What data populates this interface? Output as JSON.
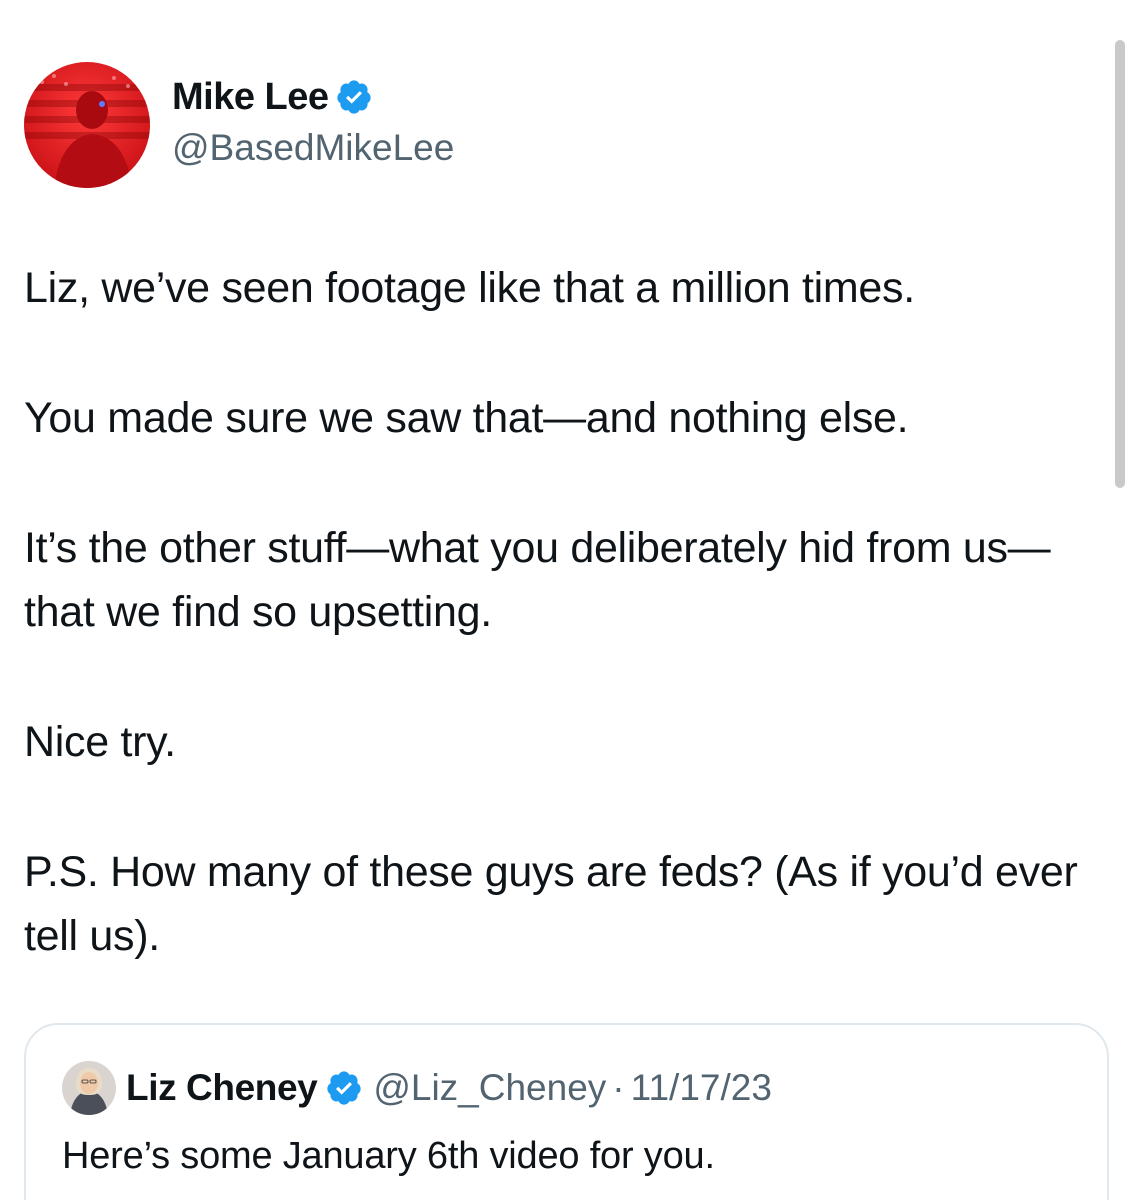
{
  "tweet": {
    "author": {
      "name": "Mike Lee",
      "handle": "@BasedMikeLee"
    },
    "paragraphs": [
      "Liz, we’ve seen footage like that a million times.",
      "You made sure we saw that—and nothing else.",
      "It’s the other stuff—what you deliberately hid from us—that we find so upsetting.",
      "Nice try.",
      "P.S. How many of these guys are feds? (As if you’d ever tell us)."
    ]
  },
  "quoted_tweet": {
    "author": {
      "name": "Liz Cheney",
      "handle": "@Liz_Cheney"
    },
    "separator": "·",
    "date": "11/17/23",
    "text": "Here’s some January 6th video for you."
  },
  "colors": {
    "verified_badge": "#1d9bf0",
    "secondary_text": "#536471",
    "primary_text": "#0f1419",
    "avatar_tint": "#e0191c"
  },
  "icons": {
    "verified": "verified-badge-icon"
  }
}
